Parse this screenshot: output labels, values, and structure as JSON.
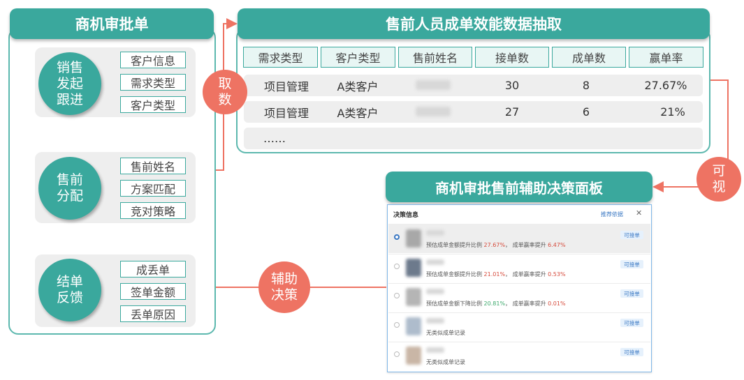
{
  "left": {
    "title": "商机审批单",
    "stages": [
      {
        "circle": "销售\n发起\n跟进",
        "tags": [
          "客户信息",
          "需求类型",
          "客户类型"
        ]
      },
      {
        "circle": "售前\n分配",
        "tags": [
          "售前姓名",
          "方案匹配",
          "竞对策略"
        ]
      },
      {
        "circle": "结单\n反馈",
        "tags": [
          "成丢单",
          "签单金额",
          "丢单原因"
        ]
      }
    ]
  },
  "top": {
    "title": "售前人员成单效能数据抽取",
    "headers": [
      "需求类型",
      "客户类型",
      "售前姓名",
      "接单数",
      "成单数",
      "赢单率"
    ],
    "rows": [
      [
        "项目管理",
        "A类客户",
        "",
        "30",
        "8",
        "27.67%"
      ],
      [
        "项目管理",
        "A类客户",
        "",
        "27",
        "6",
        "21%"
      ]
    ],
    "ellipsis": "……"
  },
  "bottom": {
    "title": "商机审批售前辅助决策面板",
    "panel_title": "决策信息",
    "panel_link": "推荐依据",
    "close": "✕",
    "items": [
      {
        "prefix": "预估成单金额提升比例",
        "pct": "27.67%",
        "mid": "，  成单赢率提升",
        "pct2": "6.47%",
        "badge": "可接单",
        "selected": true,
        "pct_color": "#d64a3b"
      },
      {
        "prefix": "预估成单金额提升比例",
        "pct": "21.01%",
        "mid": "，  成单赢率提升",
        "pct2": "0.53%",
        "badge": "可接单",
        "selected": false,
        "pct_color": "#d64a3b"
      },
      {
        "prefix": "预估成单金额下降比例",
        "pct": "20.81%",
        "mid": "，  成单赢率提升",
        "pct2": "0.01%",
        "badge": "可接单",
        "selected": false,
        "pct_color": "#3aa86a"
      },
      {
        "prefix": "无类似成单记录",
        "pct": "",
        "mid": "",
        "pct2": "",
        "badge": "可接单",
        "selected": false,
        "pct_color": "#d64a3b"
      },
      {
        "prefix": "无类似成单记录",
        "pct": "",
        "mid": "",
        "pct2": "",
        "badge": "可接单",
        "selected": false,
        "pct_color": "#d64a3b"
      }
    ]
  },
  "connectors": {
    "qushu": "取\n数",
    "keshi": "可\n视",
    "fuzhu": "辅助\n决策"
  },
  "colors": {
    "teal": "#3aa89d",
    "coral": "#ee7363",
    "gray": "#eeeeee"
  }
}
